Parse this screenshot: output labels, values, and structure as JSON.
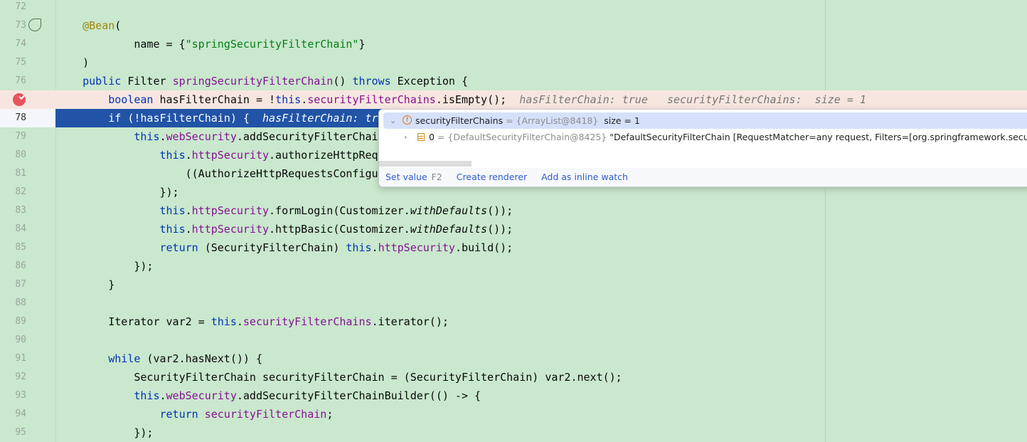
{
  "editor": {
    "first_line": 72,
    "breakpoint_line": 77,
    "current_line": 78,
    "lines": [
      {
        "n": "72",
        "t": []
      },
      {
        "n": "73",
        "t": [
          [
            "",
            "    "
          ],
          [
            "ann",
            "@Bean"
          ],
          [
            "",
            "("
          ]
        ]
      },
      {
        "n": "74",
        "t": [
          [
            "",
            "            name = {"
          ],
          [
            "str",
            "\"springSecurityFilterChain\""
          ],
          [
            "",
            "}"
          ]
        ]
      },
      {
        "n": "75",
        "t": [
          [
            "",
            "    )"
          ]
        ]
      },
      {
        "n": "76",
        "t": [
          [
            "",
            "    "
          ],
          [
            "kw",
            "public"
          ],
          [
            "",
            " Filter "
          ],
          [
            "fld",
            "springSecurityFilterChain"
          ],
          [
            "",
            "() "
          ],
          [
            "kw",
            "throws"
          ],
          [
            "",
            " Exception {"
          ]
        ]
      },
      {
        "n": "77",
        "t": [
          [
            "",
            "        "
          ],
          [
            "kw",
            "boolean"
          ],
          [
            "",
            " hasFilterChain = !"
          ],
          [
            "kw",
            "this"
          ],
          [
            "",
            "."
          ],
          [
            "fld",
            "securityFilterChains"
          ],
          [
            "",
            ".isEmpty();  "
          ],
          [
            "hint",
            "hasFilterChain: true   securityFilterChains:  size = 1"
          ]
        ]
      },
      {
        "n": "78",
        "t": [
          [
            "",
            "        "
          ],
          [
            "kw",
            "if"
          ],
          [
            "",
            " (!hasFilterChain) {  "
          ],
          [
            "hint",
            "hasFilterChain: true"
          ]
        ]
      },
      {
        "n": "79",
        "t": [
          [
            "",
            "            "
          ],
          [
            "kw",
            "this"
          ],
          [
            "",
            "."
          ],
          [
            "fld",
            "webSecurity"
          ],
          [
            "",
            ".addSecurityFilterChainBuilder(() -> {"
          ]
        ]
      },
      {
        "n": "80",
        "t": [
          [
            "",
            "                "
          ],
          [
            "kw",
            "this"
          ],
          [
            "",
            "."
          ],
          [
            "fld",
            "httpSecurity"
          ],
          [
            "",
            ".authorizeHttpRequests((requests) -> {"
          ]
        ]
      },
      {
        "n": "81",
        "t": [
          [
            "",
            "                    ((AuthorizeHttpRequestsConfigurer.AuthorizedUrl)requests.anyRequest()).authenticated();"
          ]
        ]
      },
      {
        "n": "82",
        "t": [
          [
            "",
            "                });"
          ]
        ]
      },
      {
        "n": "83",
        "t": [
          [
            "",
            "                "
          ],
          [
            "kw",
            "this"
          ],
          [
            "",
            "."
          ],
          [
            "fld",
            "httpSecurity"
          ],
          [
            "",
            ".formLogin(Customizer."
          ],
          [
            "it",
            "withDefaults"
          ],
          [
            "",
            "());"
          ]
        ]
      },
      {
        "n": "84",
        "t": [
          [
            "",
            "                "
          ],
          [
            "kw",
            "this"
          ],
          [
            "",
            "."
          ],
          [
            "fld",
            "httpSecurity"
          ],
          [
            "",
            ".httpBasic(Customizer."
          ],
          [
            "it",
            "withDefaults"
          ],
          [
            "",
            "());"
          ]
        ]
      },
      {
        "n": "85",
        "t": [
          [
            "",
            "                "
          ],
          [
            "kw",
            "return"
          ],
          [
            "",
            " (SecurityFilterChain) "
          ],
          [
            "kw",
            "this"
          ],
          [
            "",
            "."
          ],
          [
            "fld",
            "httpSecurity"
          ],
          [
            "",
            ".build();"
          ]
        ]
      },
      {
        "n": "86",
        "t": [
          [
            "",
            "            });"
          ]
        ]
      },
      {
        "n": "87",
        "t": [
          [
            "",
            "        }"
          ]
        ]
      },
      {
        "n": "88",
        "t": []
      },
      {
        "n": "89",
        "t": [
          [
            "",
            "        Iterator var2 = "
          ],
          [
            "kw",
            "this"
          ],
          [
            "",
            "."
          ],
          [
            "fld",
            "securityFilterChains"
          ],
          [
            "",
            ".iterator();"
          ]
        ]
      },
      {
        "n": "90",
        "t": []
      },
      {
        "n": "91",
        "t": [
          [
            "",
            "        "
          ],
          [
            "kw",
            "while"
          ],
          [
            "",
            " (var2.hasNext()) {"
          ]
        ]
      },
      {
        "n": "92",
        "t": [
          [
            "",
            "            SecurityFilterChain securityFilterChain = (SecurityFilterChain) var2.next();"
          ]
        ]
      },
      {
        "n": "93",
        "t": [
          [
            "",
            "            "
          ],
          [
            "kw",
            "this"
          ],
          [
            "",
            "."
          ],
          [
            "fld",
            "webSecurity"
          ],
          [
            "",
            ".addSecurityFilterChainBuilder(() -> {"
          ]
        ]
      },
      {
        "n": "94",
        "t": [
          [
            "",
            "                "
          ],
          [
            "kw",
            "return"
          ],
          [
            "",
            " "
          ],
          [
            "fld",
            "securityFilterChain"
          ],
          [
            "",
            ";"
          ]
        ]
      },
      {
        "n": "95",
        "t": [
          [
            "",
            "            });"
          ]
        ]
      }
    ]
  },
  "popup": {
    "root": {
      "name": "securityFilterChains",
      "eq": " = ",
      "type": "{ArrayList@8418}",
      "value": "size = 1",
      "icon": "field-icon"
    },
    "child": {
      "name": "0",
      "eq": " = ",
      "type": "{DefaultSecurityFilterChain@8425}",
      "value": " \"DefaultSecurityFilterChain [RequestMatcher=any request, Filters=[org.springframework.secu...",
      "icon": "array-element-icon"
    },
    "actions": {
      "set_value": "Set value",
      "set_value_key": "F2",
      "create_renderer": "Create renderer",
      "add_inline_watch": "Add as inline watch"
    }
  },
  "colors": {
    "background": "#c9e8cd",
    "current_line": "#2154a6",
    "breakpoint_line": "#f7e6df",
    "keyword": "#0033b3",
    "field": "#871094",
    "string": "#067d17",
    "annotation": "#9e880d"
  }
}
